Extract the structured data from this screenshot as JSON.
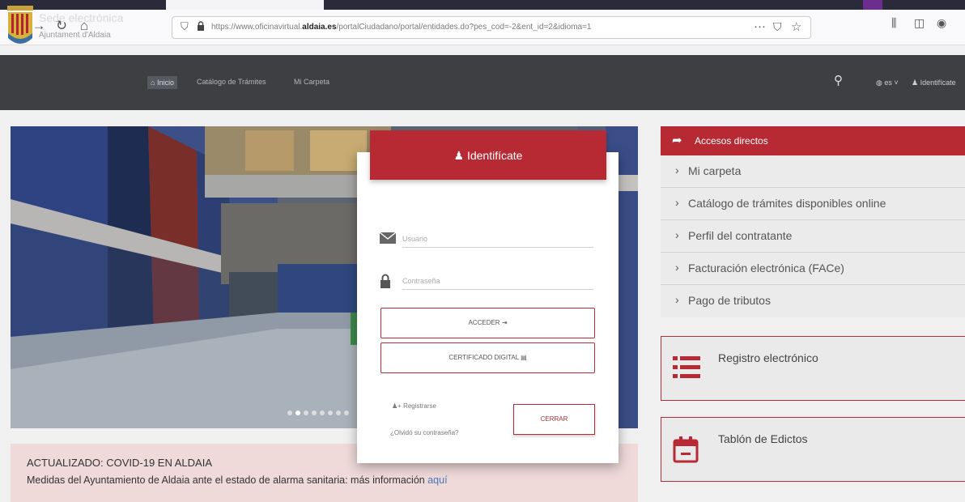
{
  "browser": {
    "url_prefix": "https://www.oficinavirtual.",
    "url_domain": "aldaia.es",
    "url_rest": "/portalCiudadano/portal/entidades.do?pes_cod=-2&ent_id=2&idioma=1"
  },
  "header": {
    "brand_title": "Sede electrónica",
    "brand_subtitle": "Ajuntament d'Aldaia",
    "nav_home": "Inicio",
    "nav_catalog": "Catálogo de Trámites",
    "nav_folder": "Mi Carpeta",
    "lang": "es",
    "identify": "Identifícate"
  },
  "hero": {
    "slides": 8,
    "active_slide": 2
  },
  "covid": {
    "title": "ACTUALIZADO: COVID-19 EN ALDAIA",
    "text": "Medidas del Ayuntamiento de Aldaia ante el estado de alarma sanitaria: más información",
    "link": "aquí"
  },
  "modal": {
    "title": "Identifícate",
    "user_placeholder": "Usuario",
    "password_placeholder": "Contraseña",
    "access_button": "ACCEDER",
    "certificate_button": "CERTIFICADO DIGITAL",
    "register_link": "Registrarse",
    "forgot_link": "¿Olvidó su contraseña?",
    "close_button": "CERRAR"
  },
  "quick_access": {
    "title": "Accesos directos",
    "items": [
      "Mi carpeta",
      "Catálogo de trámites disponibles online",
      "Perfil del contratante",
      "Facturación electrónica (FACe)",
      "Pago de tributos"
    ]
  },
  "cards": {
    "registry": "Registro electrónico",
    "edicts": "Tablón de Edictos"
  },
  "colors": {
    "accent": "#b72a34",
    "header_bg": "#3d3f43",
    "link": "#4a78b8"
  }
}
